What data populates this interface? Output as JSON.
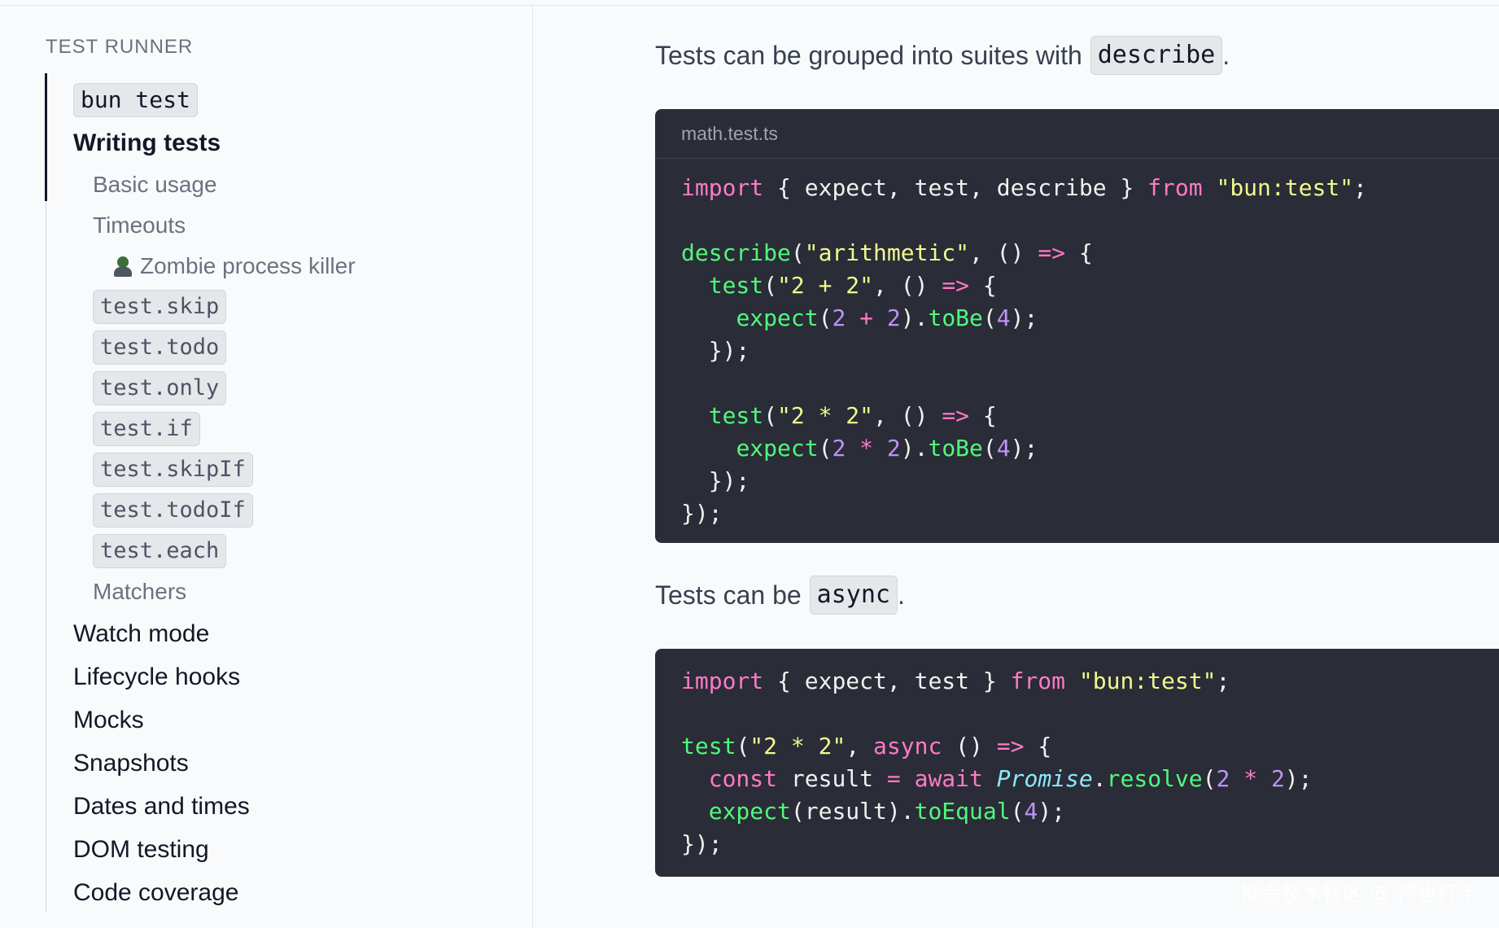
{
  "sidebar": {
    "section_title": "TEST RUNNER",
    "items": {
      "bun_test": "bun test",
      "writing_tests": "Writing tests",
      "basic_usage": "Basic usage",
      "timeouts": "Timeouts",
      "zombie_killer": "Zombie process killer",
      "test_skip": "test.skip",
      "test_todo": "test.todo",
      "test_only": "test.only",
      "test_if": "test.if",
      "test_skipIf": "test.skipIf",
      "test_todoIf": "test.todoIf",
      "test_each": "test.each",
      "matchers": "Matchers",
      "watch_mode": "Watch mode",
      "lifecycle_hooks": "Lifecycle hooks",
      "mocks": "Mocks",
      "snapshots": "Snapshots",
      "dates_and_times": "Dates and times",
      "dom_testing": "DOM testing",
      "code_coverage": "Code coverage"
    },
    "active_item": "Writing tests"
  },
  "main": {
    "para1_text": "Tests can be grouped into suites with",
    "para1_code": "describe",
    "para1_end": ".",
    "block1_filename": "math.test.ts",
    "para2_text": "Tests can be",
    "para2_code": "async",
    "para2_end": "."
  },
  "watermark": "掘金技术社区 @ 神也打卡",
  "colors": {
    "code_bg": "#2a2c37",
    "keyword": "#ff7ac6",
    "string": "#f1fa8c",
    "function": "#50fa7b",
    "number": "#bd93f9",
    "type": "#8be9fd"
  }
}
